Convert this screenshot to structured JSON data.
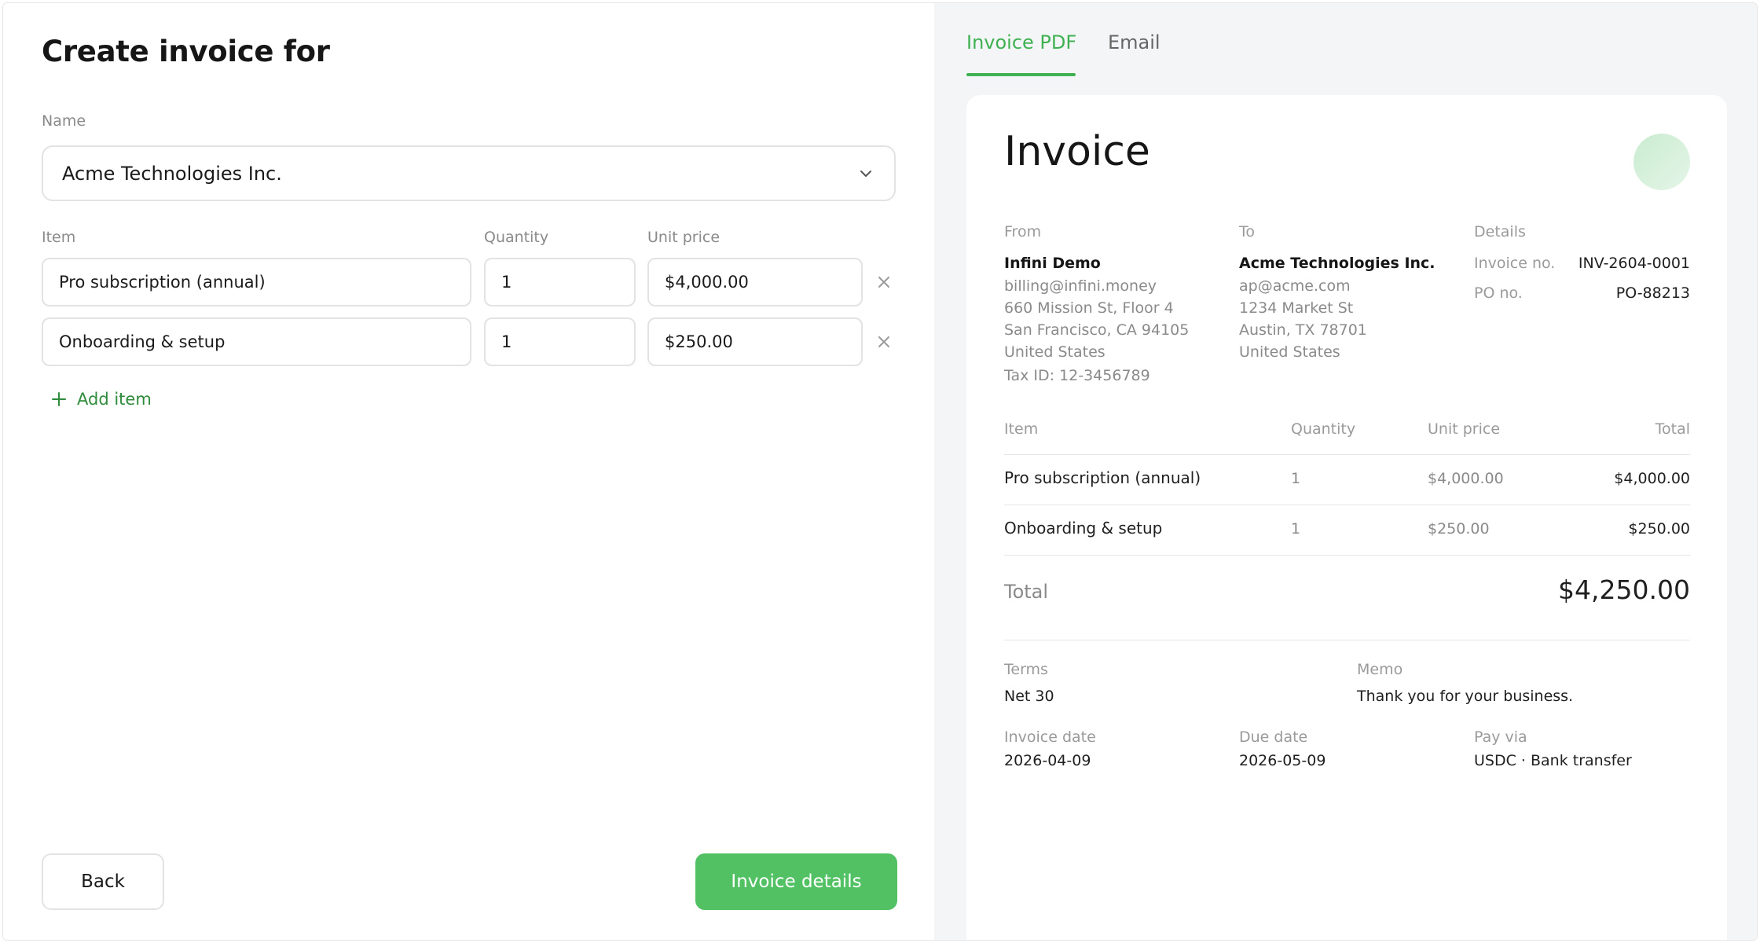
{
  "left": {
    "title": "Create invoice for",
    "name_label": "Name",
    "customer_value": "Acme Technologies Inc.",
    "columns": {
      "item": "Item",
      "quantity": "Quantity",
      "unit_price": "Unit price"
    },
    "line_items": [
      {
        "item": "Pro subscription (annual)",
        "quantity": "1",
        "unit_price": "$4,000.00"
      },
      {
        "item": "Onboarding & setup",
        "quantity": "1",
        "unit_price": "$250.00"
      }
    ],
    "add_item_label": "Add item",
    "back_label": "Back",
    "primary_label": "Invoice details"
  },
  "right": {
    "tabs": [
      {
        "label": "Invoice PDF",
        "active": true
      },
      {
        "label": "Email",
        "active": false
      }
    ],
    "invoice": {
      "title": "Invoice",
      "from_label": "From",
      "from_name": "Infini Demo",
      "from_lines": [
        "billing@infini.money",
        "660 Mission St, Floor 4",
        "San Francisco, CA 94105",
        "United States",
        "Tax ID: 12-3456789"
      ],
      "to_label": "To",
      "to_name": "Acme Technologies Inc.",
      "to_lines": [
        "ap@acme.com",
        "1234 Market St",
        "Austin, TX 78701",
        "United States"
      ],
      "details_label": "Details",
      "invoice_no_label": "Invoice no.",
      "invoice_no": "INV-2604-0001",
      "po_no_label": "PO no.",
      "po_no": "PO-88213",
      "table_headers": {
        "item": "Item",
        "quantity": "Quantity",
        "unit_price": "Unit price",
        "total": "Total"
      },
      "rows": [
        {
          "item": "Pro subscription (annual)",
          "quantity": "1",
          "unit_price": "$4,000.00",
          "total": "$4,000.00"
        },
        {
          "item": "Onboarding & setup",
          "quantity": "1",
          "unit_price": "$250.00",
          "total": "$250.00"
        }
      ],
      "total_label": "Total",
      "total_value": "$4,250.00",
      "terms_label": "Terms",
      "terms_value": "Net 30",
      "memo_label": "Memo",
      "memo_value": "Thank you for your business.",
      "invoice_date_label": "Invoice date",
      "invoice_date": "2026-04-09",
      "due_date_label": "Due date",
      "due_date": "2026-05-09",
      "pay_via_label": "Pay via",
      "pay_via": "USDC · Bank transfer"
    }
  },
  "colors": {
    "accent": "#52c164",
    "accent_text": "#3fb152",
    "add_item": "#2e8b3c"
  },
  "icons": [
    "chevron-down-icon",
    "close-icon",
    "plus-icon"
  ]
}
